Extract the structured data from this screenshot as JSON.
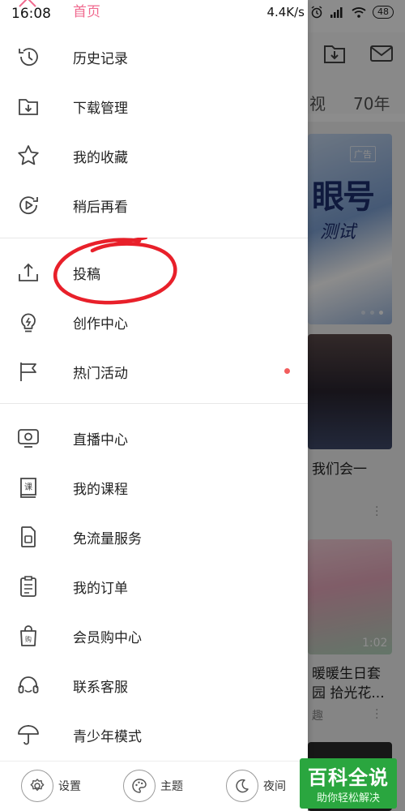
{
  "status_bar": {
    "time": "16:08",
    "network_speed": "4.4K/s",
    "battery": "48",
    "icons": [
      "alarm-icon",
      "signal-icon",
      "wifi-icon",
      "battery-icon"
    ]
  },
  "drawer": {
    "home_label": "首页",
    "groups": [
      [
        {
          "label": "历史记录",
          "icon": "history-icon"
        },
        {
          "label": "下载管理",
          "icon": "download-folder-icon"
        },
        {
          "label": "我的收藏",
          "icon": "star-icon"
        },
        {
          "label": "稍后再看",
          "icon": "watch-later-icon"
        }
      ],
      [
        {
          "label": "投稿",
          "icon": "upload-icon"
        },
        {
          "label": "创作中心",
          "icon": "lightbulb-icon"
        },
        {
          "label": "热门活动",
          "icon": "flag-icon",
          "badge_dot": true
        }
      ],
      [
        {
          "label": "直播中心",
          "icon": "tv-icon"
        },
        {
          "label": "我的课程",
          "icon": "course-book-icon"
        },
        {
          "label": "免流量服务",
          "icon": "sim-card-icon"
        },
        {
          "label": "我的订单",
          "icon": "order-list-icon"
        },
        {
          "label": "会员购中心",
          "icon": "shopping-bag-icon"
        },
        {
          "label": "联系客服",
          "icon": "headset-icon"
        },
        {
          "label": "青少年模式",
          "icon": "umbrella-icon"
        }
      ]
    ],
    "bottom": {
      "settings_label": "设置",
      "theme_label": "主题",
      "night_label": "夜间"
    },
    "annotation": "red-circle-around-upload"
  },
  "background": {
    "tabs": [
      "视",
      "70年"
    ],
    "ad_badge": "广告",
    "ad_text_main": "眼号",
    "ad_text_sub": "测试",
    "card2_title": "我们会一",
    "card3_title_line1": "暖暖生日套",
    "card3_title_line2": "园 拾光花...",
    "card3_sub": "趣",
    "card3_duration": "1:02"
  },
  "watermark": {
    "title": "百科全说",
    "subtitle": "助你轻松解决"
  },
  "colors": {
    "accent_pink": "#f06a8f",
    "badge_red": "#f25d5d",
    "watermark_green": "#2aa63f",
    "annotation_red": "#e8202a"
  }
}
